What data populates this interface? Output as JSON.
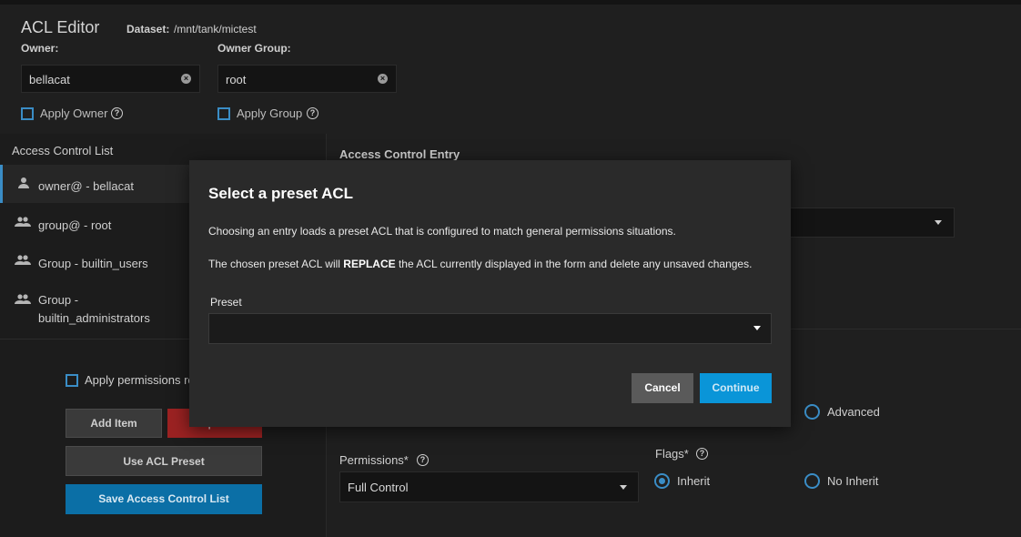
{
  "header": {
    "title": "ACL Editor",
    "dataset_label": "Dataset:",
    "dataset_value": "/mnt/tank/mictest",
    "owner_label": "Owner:",
    "owner_value": "bellacat",
    "owner_group_label": "Owner Group:",
    "owner_group_value": "root",
    "apply_owner_label": "Apply Owner",
    "apply_group_label": "Apply Group"
  },
  "sidebar": {
    "heading": "Access Control List",
    "items": [
      {
        "label": "owner@ - bellacat",
        "icon": "person-icon"
      },
      {
        "label": "group@ - root",
        "icon": "group-icon"
      },
      {
        "label": "Group - builtin_users",
        "icon": "group-icon"
      },
      {
        "label": "Group -",
        "label2": "builtin_administrators",
        "icon": "group-icon"
      }
    ],
    "apply_recursive_label": "Apply permissions re",
    "add_item_label": "Add Item",
    "strip_acl_label": "Strip ACL",
    "use_preset_label": "Use ACL Preset",
    "save_label": "Save Access Control List"
  },
  "main": {
    "ace_title": "Access Control Entry",
    "advanced_label": "Advanced",
    "permissions_label": "Permissions*",
    "permissions_value": "Full Control",
    "flags_label": "Flags*",
    "inherit_label": "Inherit",
    "no_inherit_label": "No Inherit"
  },
  "dialog": {
    "title": "Select a preset ACL",
    "line1": "Choosing an entry loads a preset ACL that is configured to match general permissions situations.",
    "line2_pre": "The chosen preset ACL will ",
    "line2_bold": "REPLACE",
    "line2_post": " the ACL currently displayed in the form and delete any unsaved changes.",
    "preset_label": "Preset",
    "preset_value": "",
    "cancel_label": "Cancel",
    "continue_label": "Continue"
  },
  "colors": {
    "accent": "#3a8dc6",
    "continue_button": "#0a95d8",
    "save_button": "#0b6fa6",
    "strip_button": "#9b2222"
  }
}
